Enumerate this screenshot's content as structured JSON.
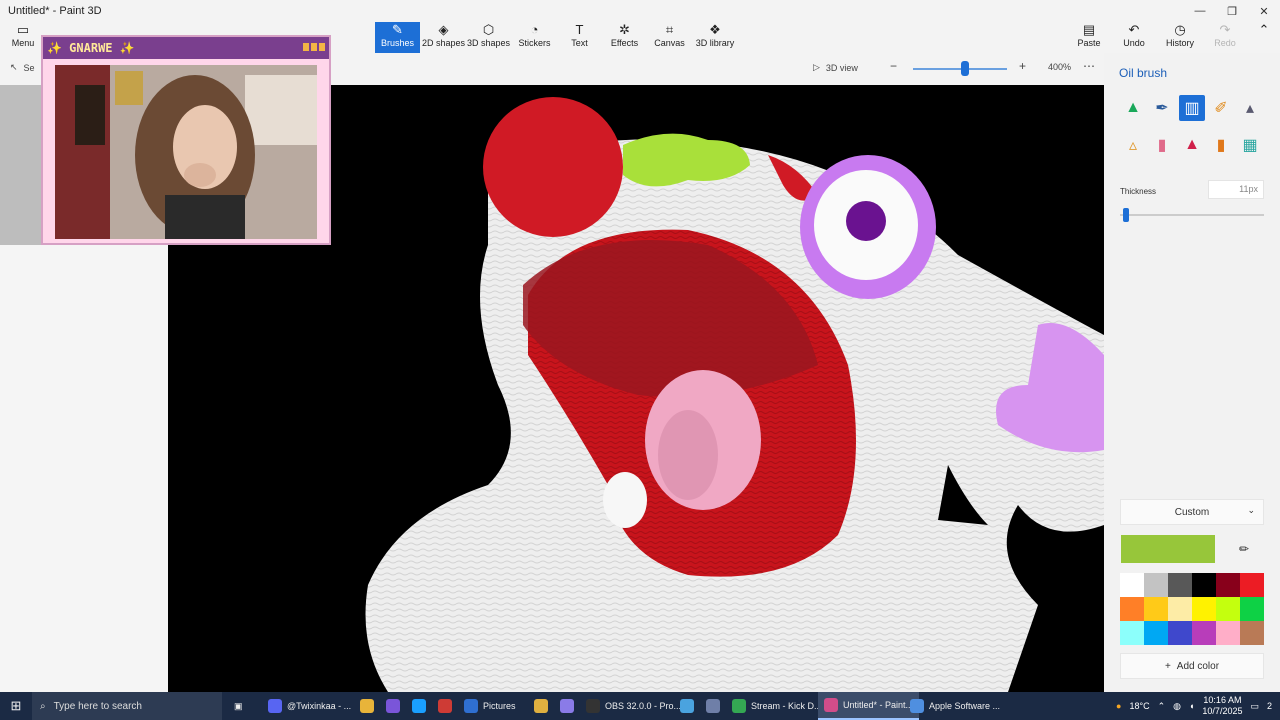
{
  "window": {
    "title": "Untitled* - Paint 3D",
    "controls": [
      "—",
      "❐",
      "✕"
    ]
  },
  "ribbon": {
    "menu": {
      "label": "Menu",
      "icon": "menu-icon"
    },
    "tools": [
      {
        "label": "Brushes",
        "icon": "brush-icon",
        "active": true
      },
      {
        "label": "2D shapes",
        "icon": "2d-shapes-icon"
      },
      {
        "label": "3D shapes",
        "icon": "3d-shapes-icon"
      },
      {
        "label": "Stickers",
        "icon": "stickers-icon"
      },
      {
        "label": "Text",
        "icon": "text-icon"
      },
      {
        "label": "Effects",
        "icon": "effects-icon"
      },
      {
        "label": "Canvas",
        "icon": "canvas-icon"
      },
      {
        "label": "3D library",
        "icon": "3d-library-icon"
      }
    ],
    "right": [
      {
        "label": "Paste",
        "icon": "paste-icon"
      },
      {
        "label": "Undo",
        "icon": "undo-icon"
      },
      {
        "label": "History",
        "icon": "history-icon"
      },
      {
        "label": "Redo",
        "icon": "redo-icon",
        "disabled": true
      }
    ]
  },
  "toolbar": {
    "select_label": "Se",
    "view_label": "3D view",
    "zoom": "400%",
    "zoom_level": 0.55
  },
  "webcam": {
    "overlay_title": "✨ GNARWE ✨"
  },
  "panel": {
    "title": "Oil brush",
    "brushes": [
      "marker-icon",
      "calligraphy-pen-icon",
      "oil-brush-icon",
      "watercolor-icon",
      "pencil-icon",
      "eraser-icon",
      "crayon-icon",
      "pixel-pen-icon",
      "spray-can-icon",
      "fill-icon"
    ],
    "thickness_label": "Thickness",
    "thickness_value": "11px",
    "thickness_level": 0.02,
    "color_mode": "Custom",
    "current_color": "#97c63a",
    "palette": [
      "#ffffff",
      "#c3c3c3",
      "#585858",
      "#000000",
      "#88001b",
      "#ec1c24",
      "#ff7f27",
      "#ffca18",
      "#fdeca6",
      "#fff200",
      "#c4ff0e",
      "#0ed145",
      "#8cfffb",
      "#00a8f3",
      "#3f48cc",
      "#b83dba",
      "#ffaec8",
      "#b97a56"
    ],
    "add_color_label": "Add color"
  },
  "taskbar": {
    "search_placeholder": "Type here to search",
    "apps": [
      {
        "label": "@Twixinkaa - ...",
        "color": "#5865f2"
      },
      {
        "label": "",
        "color": "#e8b43a"
      },
      {
        "label": "",
        "color": "#7a55d9"
      },
      {
        "label": "",
        "color": "#1a9fff"
      },
      {
        "label": "",
        "color": "#ce3b35"
      },
      {
        "label": "Pictures",
        "color": "#2f6fd1"
      },
      {
        "label": "",
        "color": "#e0b040"
      },
      {
        "label": "",
        "color": "#8a7be8"
      },
      {
        "label": "OBS 32.0.0 - Pro...",
        "color": "#333333"
      },
      {
        "label": "",
        "color": "#4aa3df"
      },
      {
        "label": "",
        "color": "#6f7fa8"
      },
      {
        "label": "Stream - Kick D...",
        "color": "#34a853"
      },
      {
        "label": "Untitled* - Paint...",
        "color": "#d14d8a",
        "active": true
      },
      {
        "label": "Apple Software ...",
        "color": "#4f8fe0"
      }
    ],
    "weather": "18°C",
    "time": "10:16 AM",
    "date": "10/7/2025",
    "notifications": "2"
  }
}
